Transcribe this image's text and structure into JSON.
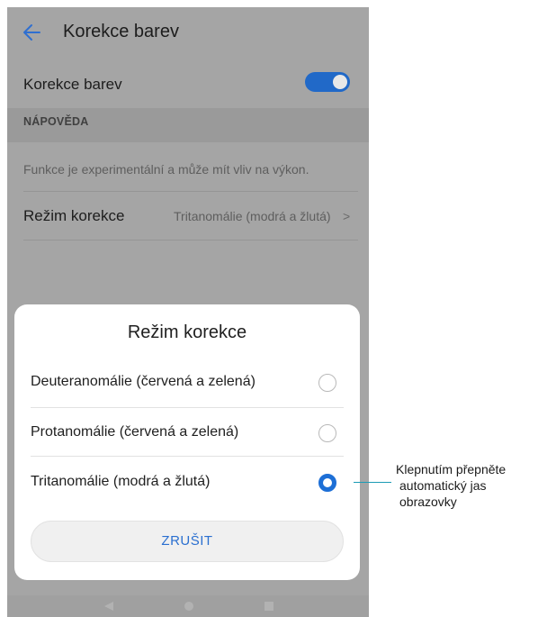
{
  "app_bar": {
    "title": "Korekce barev"
  },
  "settings": {
    "toggle_label": "Korekce barev",
    "toggle_on": true,
    "section_title": "NÁPOVĚDA",
    "hint": "Funkce je experimentální a může mít vliv na výkon.",
    "mode_label": "Režim korekce",
    "mode_value": "Tritanomálie (modrá a žlutá)",
    "chevron": ">"
  },
  "dialog": {
    "title": "Režim korekce",
    "options": [
      {
        "label": "Deuteranomálie (červená a zelená)",
        "selected": false
      },
      {
        "label": "Protanomálie (červená a zelená)",
        "selected": false
      },
      {
        "label": "Tritanomálie (modrá a žlutá)",
        "selected": true
      }
    ],
    "cancel_label": "ZRUŠIT"
  },
  "annotation": {
    "line1": "Klepnutím přepněte",
    "line2": "automatický jas",
    "line3": "obrazovky"
  },
  "colors": {
    "accent": "#1d6fd6",
    "callout": "#1b9bb5",
    "dim_overlay": "#a5a5a5"
  }
}
